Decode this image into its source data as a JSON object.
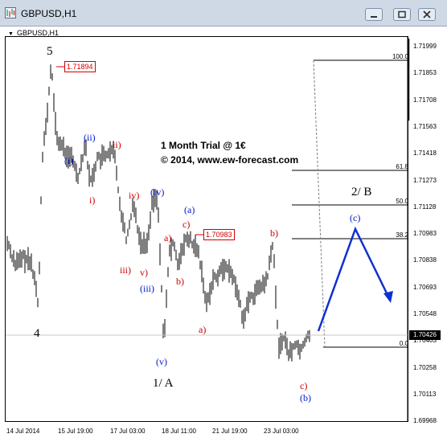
{
  "window": {
    "title": "GBPUSD,H1"
  },
  "panel": {
    "label": "GBPUSD,H1"
  },
  "trial": {
    "line1": "1 Month Trial @ 1€",
    "line2": "© 2014, www.ew-forecast.com"
  },
  "price_axis": {
    "ticks": [
      "1.71999",
      "1.71853",
      "1.71708",
      "1.71563",
      "1.71418",
      "1.71273",
      "1.71128",
      "1.70983",
      "1.70838",
      "1.70693",
      "1.70548",
      "1.70403",
      "1.70258",
      "1.70113",
      "1.69968"
    ],
    "current_price": "1.70426"
  },
  "time_axis": {
    "ticks": [
      "14 Jul 2014",
      "15 Jul 19:00",
      "17 Jul 03:00",
      "18 Jul 11:00",
      "21 Jul 19:00",
      "23 Jul 03:00"
    ]
  },
  "fib_levels": [
    {
      "label": "100.0"
    },
    {
      "label": "61.8"
    },
    {
      "label": "50.0"
    },
    {
      "label": "38.2"
    },
    {
      "label": "0.0"
    }
  ],
  "price_tags": {
    "high": "1.71894",
    "low_b": "1.70983"
  },
  "wave_labels": {
    "w5": "5",
    "w4": "4",
    "wA": "1/ A",
    "wB": "2/ B",
    "i_blue": "(i)",
    "ii_blue": "(ii)",
    "iii_blue": "(iii)",
    "iv_blue": "(iv)",
    "v_blue": "(v)",
    "i_red": "i)",
    "ii_red": "ii)",
    "iii_red": "iii)",
    "iv_red": "iv)",
    "v_red": "v)",
    "a_blue": "(a)",
    "b_blue": "(b)",
    "c_blue": "(c)",
    "a_red1": "a)",
    "b_red1": "b)",
    "c_red1": "c)",
    "a_red2": "a)",
    "b_red2": "b)",
    "c_red2": "c)"
  },
  "colors": {
    "wave_blue": "#0018c8",
    "wave_red": "#d00000",
    "forecast_arrow": "#1030d0"
  }
}
